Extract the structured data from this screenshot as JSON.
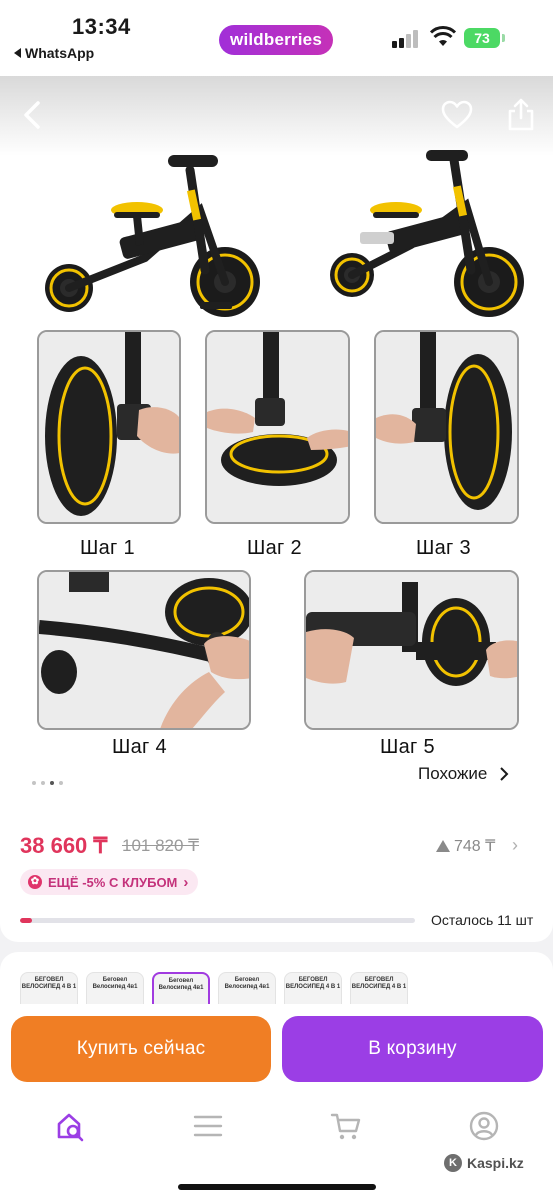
{
  "status_bar": {
    "time": "13:34",
    "back_app": "WhatsApp",
    "battery": "73",
    "center_app": "wildberries"
  },
  "product": {
    "step_labels": [
      "Шаг 1",
      "Шаг 2",
      "Шаг 3",
      "Шаг 4",
      "Шаг 5"
    ],
    "similar_label": "Похожие",
    "gallery_dots": {
      "count": 4,
      "active_index": 2
    }
  },
  "price": {
    "current": "38 660 ₸",
    "old": "101 820 ₸",
    "rating_count": "748 ₸",
    "club_label": "ЕЩЁ -5% С КЛУБОМ",
    "stock_text": "Осталось 11 шт",
    "stock_fraction": 0.03
  },
  "variants": [
    {
      "label": "БЕГОВЕЛ ВЕЛОСИПЕД 4 В 1"
    },
    {
      "label": "Беговел Велосипед 4в1"
    },
    {
      "label": "Беговел Велосипед 4в1"
    },
    {
      "label": "Беговел Велосипед 4в1"
    },
    {
      "label": "БЕГОВЕЛ ВЕЛОСИПЕД 4 В 1"
    },
    {
      "label": "БЕГОВЕЛ ВЕЛОСИПЕД 4 В 1"
    }
  ],
  "actions": {
    "buy_now": "Купить сейчас",
    "add_to_cart": "В корзину"
  },
  "watermark": "Kaspi.kz",
  "colors": {
    "brand_purple": "#9b3ee5",
    "buy_orange": "#f07e24",
    "price_red": "#e0355c",
    "bike_yellow": "#f2c200"
  },
  "icons": {
    "tabs": [
      "home-search-icon",
      "catalog-icon",
      "cart-icon",
      "profile-icon"
    ]
  }
}
